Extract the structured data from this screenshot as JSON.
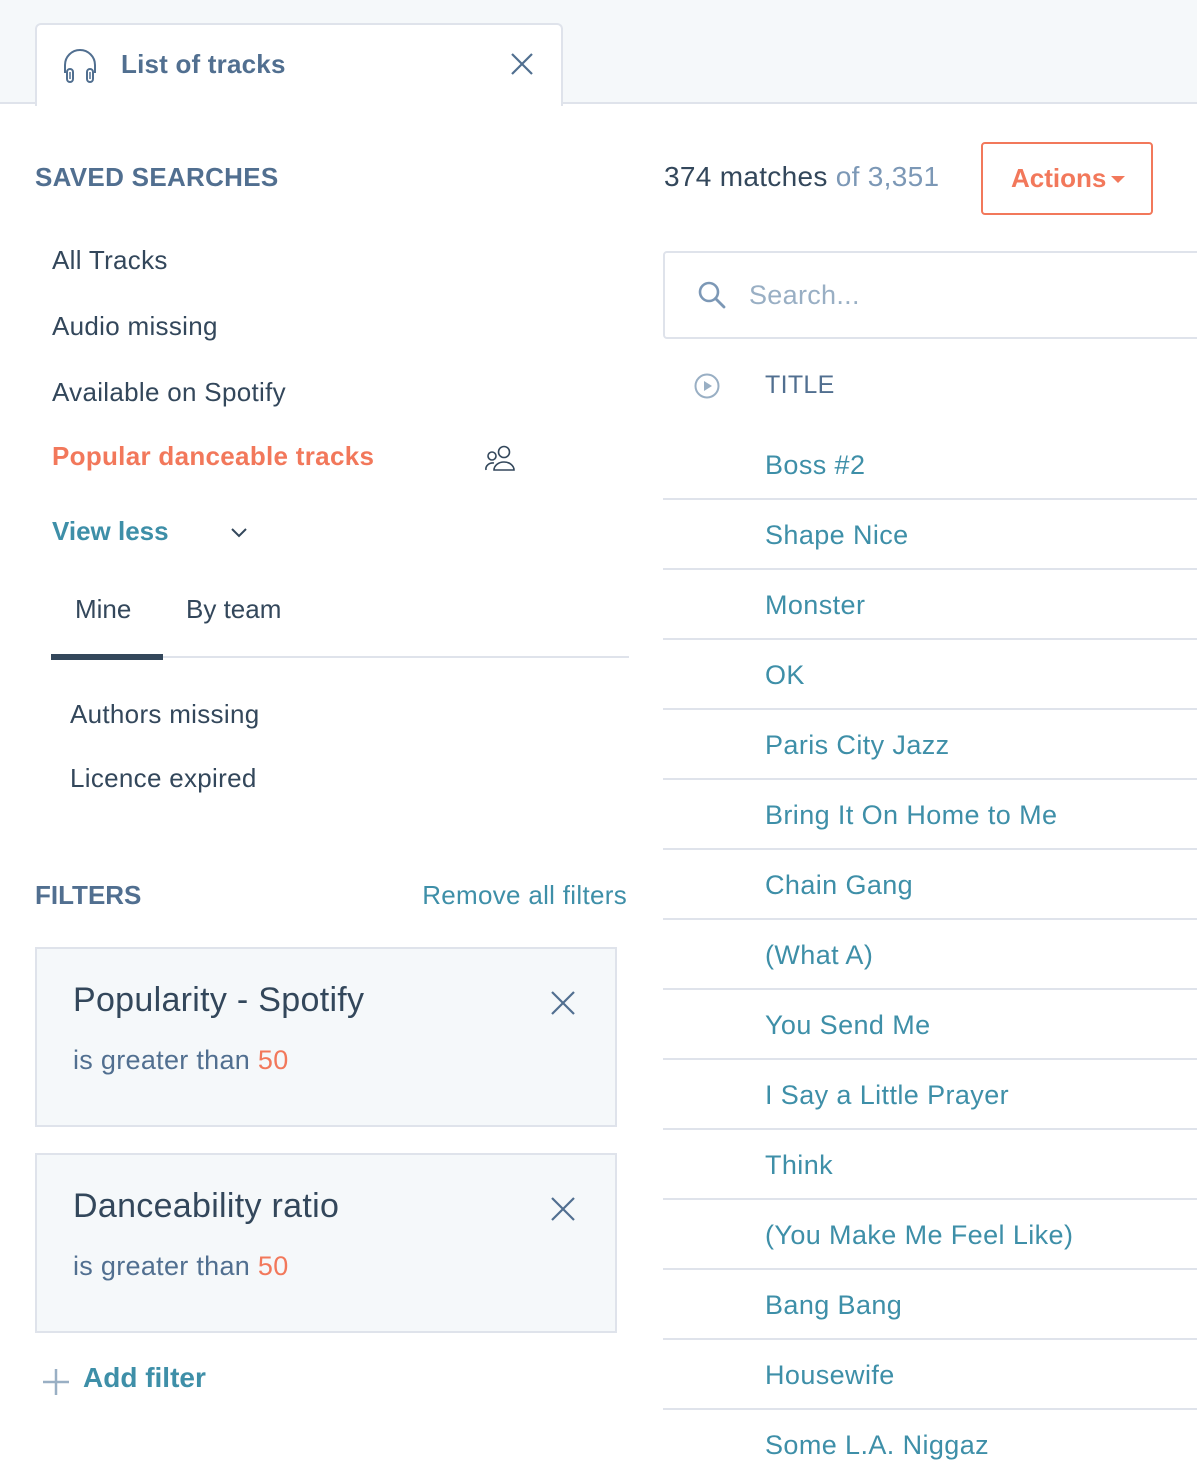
{
  "tab": {
    "icon": "headphones-icon",
    "title": "List of tracks",
    "close_icon": "close-icon"
  },
  "saved_searches": {
    "title": "SAVED SEARCHES",
    "items": [
      {
        "label": "All Tracks",
        "active": false
      },
      {
        "label": "Audio missing",
        "active": false
      },
      {
        "label": "Available on Spotify",
        "active": false
      },
      {
        "label": "Popular danceable tracks",
        "active": true,
        "shared_icon": "team-icon"
      }
    ],
    "view_toggle": "View less",
    "tabs": [
      {
        "label": "Mine",
        "active": true
      },
      {
        "label": "By team",
        "active": false
      }
    ],
    "mine_items": [
      {
        "label": "Authors missing"
      },
      {
        "label": "Licence expired"
      }
    ]
  },
  "filters": {
    "title": "FILTERS",
    "remove_all": "Remove all filters",
    "items": [
      {
        "name": "Popularity - Spotify",
        "condition": "is greater than",
        "value": "50"
      },
      {
        "name": "Danceability ratio",
        "condition": "is greater than",
        "value": "50"
      }
    ],
    "add_label": "Add filter"
  },
  "results": {
    "matches": "374 matches",
    "of_total": "of 3,351",
    "actions_label": "Actions",
    "search_placeholder": "Search...",
    "search_value": "",
    "column_title": "TITLE",
    "tracks": [
      "Boss #2",
      "Shape Nice",
      "Monster",
      "OK",
      "Paris City Jazz",
      "Bring It On Home to Me",
      "Chain Gang",
      "(What A)",
      "You Send Me",
      "I Say a Little Prayer",
      "Think",
      "(You Make Me Feel Like)",
      "Bang Bang",
      "Housewife",
      "Some L.A. Niggaz"
    ]
  },
  "colors": {
    "accent": "#f2785b",
    "link": "#3e8fa8",
    "text": "#33475b",
    "muted": "#516f90",
    "border": "#dfe3eb",
    "panel_bg": "#f5f8fa"
  }
}
